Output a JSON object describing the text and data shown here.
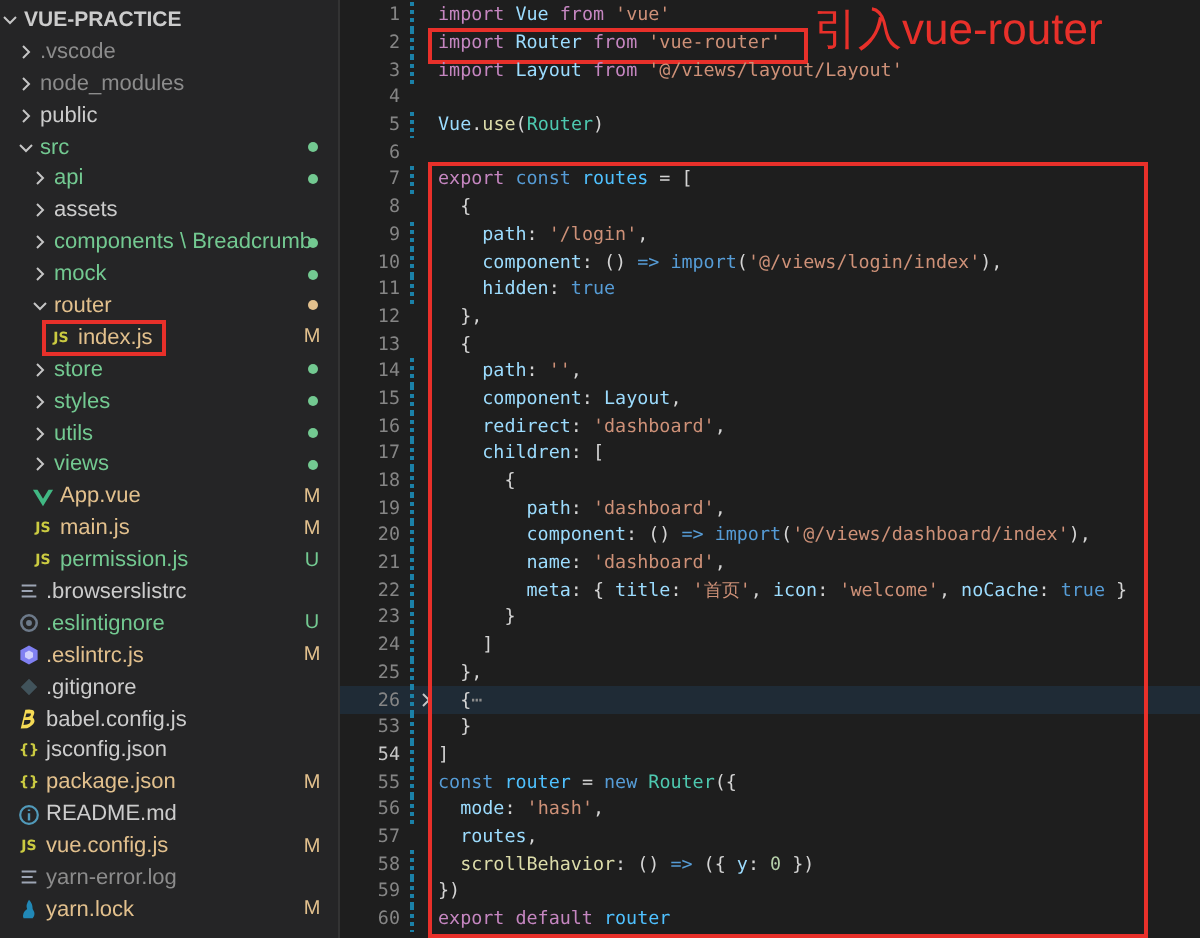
{
  "explorer": {
    "root": {
      "name": "VUE-PRACTICE",
      "kind": "folder",
      "expanded": true,
      "color": "#cccccc",
      "children": [
        {
          "name": ".vscode",
          "kind": "folder",
          "expanded": false,
          "color": "#8c8c8c"
        },
        {
          "name": "node_modules",
          "kind": "folder",
          "expanded": false,
          "color": "#8c8c8c"
        },
        {
          "name": "public",
          "kind": "folder",
          "expanded": false,
          "color": "#cccccc"
        },
        {
          "name": "src",
          "kind": "folder",
          "expanded": true,
          "color": "#73c991",
          "dot": true,
          "children": [
            {
              "name": "api",
              "kind": "folder",
              "expanded": false,
              "color": "#73c991",
              "dot": true
            },
            {
              "name": "assets",
              "kind": "folder",
              "expanded": false,
              "color": "#cccccc"
            },
            {
              "name": "components \\ Breadcrumb",
              "kind": "folder",
              "expanded": false,
              "color": "#73c991",
              "dot": true
            },
            {
              "name": "mock",
              "kind": "folder",
              "expanded": false,
              "color": "#73c991",
              "dot": true
            },
            {
              "name": "router",
              "kind": "folder",
              "expanded": true,
              "color": "#e2c08d",
              "dot": true,
              "children": [
                {
                  "name": "index.js",
                  "kind": "js",
                  "icon_text": "JS",
                  "color": "#e2c08d",
                  "status": "M",
                  "boxed": true
                }
              ]
            },
            {
              "name": "store",
              "kind": "folder",
              "expanded": false,
              "color": "#73c991",
              "dot": true
            },
            {
              "name": "styles",
              "kind": "folder",
              "expanded": false,
              "color": "#73c991",
              "dot": true
            },
            {
              "name": "utils",
              "kind": "folder",
              "expanded": false,
              "color": "#73c991",
              "dot": true
            },
            {
              "name": "views",
              "kind": "folder",
              "expanded": false,
              "color": "#73c991",
              "dot": true
            },
            {
              "name": "App.vue",
              "kind": "vue",
              "color": "#e2c08d",
              "status": "M"
            },
            {
              "name": "main.js",
              "kind": "js",
              "icon_text": "JS",
              "color": "#e2c08d",
              "status": "M"
            },
            {
              "name": "permission.js",
              "kind": "js",
              "icon_text": "JS",
              "color": "#73c991",
              "status": "U"
            }
          ]
        },
        {
          "name": ".browserslistrc",
          "kind": "text",
          "color": "#cccccc"
        },
        {
          "name": ".eslintignore",
          "kind": "ignore",
          "color": "#73c991",
          "status": "U"
        },
        {
          "name": ".eslintrc.js",
          "kind": "eslint",
          "color": "#e2c08d",
          "status": "M"
        },
        {
          "name": ".gitignore",
          "kind": "git",
          "color": "#cccccc"
        },
        {
          "name": "babel.config.js",
          "kind": "babel",
          "color": "#cccccc"
        },
        {
          "name": "jsconfig.json",
          "kind": "json",
          "icon_text": "{}",
          "color": "#cccccc"
        },
        {
          "name": "package.json",
          "kind": "json",
          "icon_text": "{}",
          "color": "#e2c08d",
          "status": "M"
        },
        {
          "name": "README.md",
          "kind": "info",
          "color": "#cccccc"
        },
        {
          "name": "vue.config.js",
          "kind": "js",
          "icon_text": "JS",
          "color": "#e2c08d",
          "status": "M"
        },
        {
          "name": "yarn-error.log",
          "kind": "text",
          "color": "#8c8c8c"
        },
        {
          "name": "yarn.lock",
          "kind": "yarn",
          "color": "#e2c08d",
          "status": "M"
        }
      ]
    }
  },
  "editor": {
    "annotation": "引入vue-router",
    "lines": [
      {
        "number": "1",
        "changed": true,
        "tokens": [
          {
            "kind": "kw",
            "text": "import "
          },
          {
            "kind": "var",
            "text": "Vue "
          },
          {
            "kind": "kw",
            "text": "from "
          },
          {
            "kind": "str",
            "text": "'vue'"
          }
        ]
      },
      {
        "number": "2",
        "changed": true,
        "boxed": true,
        "annotated": true,
        "tokens": [
          {
            "kind": "kw",
            "text": "import "
          },
          {
            "kind": "var",
            "text": "Router "
          },
          {
            "kind": "kw",
            "text": "from "
          },
          {
            "kind": "str",
            "text": "'vue-router'"
          }
        ]
      },
      {
        "number": "3",
        "changed": true,
        "tokens": [
          {
            "kind": "kw",
            "text": "import "
          },
          {
            "kind": "var",
            "text": "Layout "
          },
          {
            "kind": "kw",
            "text": "from "
          },
          {
            "kind": "str",
            "text": "'@/views/layout/Layout'"
          }
        ]
      },
      {
        "number": "4",
        "changed": false
      },
      {
        "number": "5",
        "changed": true,
        "tokens": [
          {
            "kind": "var",
            "text": "Vue"
          },
          {
            "kind": "p",
            "text": "."
          },
          {
            "kind": "fn",
            "text": "use"
          },
          {
            "kind": "p",
            "text": "("
          },
          {
            "kind": "cls",
            "text": "Router"
          },
          {
            "kind": "p",
            "text": ")"
          }
        ]
      },
      {
        "number": "6",
        "changed": false
      },
      {
        "number": "7",
        "changed": true,
        "in_region": true,
        "tokens": [
          {
            "kind": "kw",
            "text": "export "
          },
          {
            "kind": "st",
            "text": "const "
          },
          {
            "kind": "cn",
            "text": "routes "
          },
          {
            "kind": "p",
            "text": "= ["
          }
        ]
      },
      {
        "number": "8",
        "changed": false,
        "in_region": true,
        "tokens": [
          {
            "kind": "p",
            "text": "  {"
          }
        ]
      },
      {
        "number": "9",
        "changed": true,
        "in_region": true,
        "tokens": [
          {
            "kind": "var",
            "text": "    path"
          },
          {
            "kind": "p",
            "text": ": "
          },
          {
            "kind": "str",
            "text": "'/login'"
          },
          {
            "kind": "p",
            "text": ","
          }
        ]
      },
      {
        "number": "10",
        "changed": true,
        "in_region": true,
        "tokens": [
          {
            "kind": "var",
            "text": "    component"
          },
          {
            "kind": "p",
            "text": ": () "
          },
          {
            "kind": "st",
            "text": "=> import"
          },
          {
            "kind": "p",
            "text": "("
          },
          {
            "kind": "str",
            "text": "'@/views/login/index'"
          },
          {
            "kind": "p",
            "text": "),"
          }
        ]
      },
      {
        "number": "11",
        "changed": true,
        "in_region": true,
        "tokens": [
          {
            "kind": "var",
            "text": "    hidden"
          },
          {
            "kind": "p",
            "text": ": "
          },
          {
            "kind": "st",
            "text": "true"
          }
        ]
      },
      {
        "number": "12",
        "changed": false,
        "in_region": true,
        "tokens": [
          {
            "kind": "p",
            "text": "  },"
          }
        ]
      },
      {
        "number": "13",
        "changed": false,
        "in_region": true,
        "tokens": [
          {
            "kind": "p",
            "text": "  {"
          }
        ]
      },
      {
        "number": "14",
        "changed": true,
        "in_region": true,
        "tokens": [
          {
            "kind": "var",
            "text": "    path"
          },
          {
            "kind": "p",
            "text": ": "
          },
          {
            "kind": "str",
            "text": "''"
          },
          {
            "kind": "p",
            "text": ","
          }
        ]
      },
      {
        "number": "15",
        "changed": true,
        "in_region": true,
        "tokens": [
          {
            "kind": "var",
            "text": "    component"
          },
          {
            "kind": "p",
            "text": ": "
          },
          {
            "kind": "var",
            "text": "Layout"
          },
          {
            "kind": "p",
            "text": ","
          }
        ]
      },
      {
        "number": "16",
        "changed": true,
        "in_region": true,
        "tokens": [
          {
            "kind": "var",
            "text": "    redirect"
          },
          {
            "kind": "p",
            "text": ": "
          },
          {
            "kind": "str",
            "text": "'dashboard'"
          },
          {
            "kind": "p",
            "text": ","
          }
        ]
      },
      {
        "number": "17",
        "changed": true,
        "in_region": true,
        "tokens": [
          {
            "kind": "var",
            "text": "    children"
          },
          {
            "kind": "p",
            "text": ": ["
          }
        ]
      },
      {
        "number": "18",
        "changed": true,
        "in_region": true,
        "tokens": [
          {
            "kind": "p",
            "text": "      {"
          }
        ]
      },
      {
        "number": "19",
        "changed": true,
        "in_region": true,
        "tokens": [
          {
            "kind": "var",
            "text": "        path"
          },
          {
            "kind": "p",
            "text": ": "
          },
          {
            "kind": "str",
            "text": "'dashboard'"
          },
          {
            "kind": "p",
            "text": ","
          }
        ]
      },
      {
        "number": "20",
        "changed": true,
        "in_region": true,
        "tokens": [
          {
            "kind": "var",
            "text": "        component"
          },
          {
            "kind": "p",
            "text": ": () "
          },
          {
            "kind": "st",
            "text": "=> import"
          },
          {
            "kind": "p",
            "text": "("
          },
          {
            "kind": "str",
            "text": "'@/views/dashboard/index'"
          },
          {
            "kind": "p",
            "text": "),"
          }
        ]
      },
      {
        "number": "21",
        "changed": true,
        "in_region": true,
        "tokens": [
          {
            "kind": "var",
            "text": "        name"
          },
          {
            "kind": "p",
            "text": ": "
          },
          {
            "kind": "str",
            "text": "'dashboard'"
          },
          {
            "kind": "p",
            "text": ","
          }
        ]
      },
      {
        "number": "22",
        "changed": true,
        "in_region": true,
        "tokens": [
          {
            "kind": "var",
            "text": "        meta"
          },
          {
            "kind": "p",
            "text": ": { "
          },
          {
            "kind": "var",
            "text": "title"
          },
          {
            "kind": "p",
            "text": ": "
          },
          {
            "kind": "str",
            "text": "'首页'"
          },
          {
            "kind": "p",
            "text": ", "
          },
          {
            "kind": "var",
            "text": "icon"
          },
          {
            "kind": "p",
            "text": ": "
          },
          {
            "kind": "str",
            "text": "'welcome'"
          },
          {
            "kind": "p",
            "text": ", "
          },
          {
            "kind": "var",
            "text": "noCache"
          },
          {
            "kind": "p",
            "text": ": "
          },
          {
            "kind": "st",
            "text": "true"
          },
          {
            "kind": "p",
            "text": " }"
          }
        ]
      },
      {
        "number": "23",
        "changed": true,
        "in_region": true,
        "tokens": [
          {
            "kind": "p",
            "text": "      }"
          }
        ]
      },
      {
        "number": "24",
        "changed": true,
        "in_region": true,
        "tokens": [
          {
            "kind": "p",
            "text": "    ]"
          }
        ]
      },
      {
        "number": "25",
        "changed": true,
        "in_region": true,
        "tokens": [
          {
            "kind": "p",
            "text": "  },"
          }
        ]
      },
      {
        "number": "26",
        "changed": true,
        "in_region": true,
        "folded": true,
        "tokens": [
          {
            "kind": "p",
            "text": "  {"
          },
          {
            "kind": "fold",
            "text": "⋯"
          }
        ]
      },
      {
        "number": "53",
        "changed": true,
        "in_region": true,
        "tokens": [
          {
            "kind": "p",
            "text": "  }"
          }
        ]
      },
      {
        "number": "54",
        "changed": true,
        "in_region": true,
        "current": true,
        "tokens": [
          {
            "kind": "p",
            "text": "]"
          }
        ]
      },
      {
        "number": "55",
        "changed": true,
        "in_region": true,
        "tokens": [
          {
            "kind": "st",
            "text": "const "
          },
          {
            "kind": "cn",
            "text": "router "
          },
          {
            "kind": "p",
            "text": "= "
          },
          {
            "kind": "st",
            "text": "new "
          },
          {
            "kind": "cls",
            "text": "Router"
          },
          {
            "kind": "p",
            "text": "({"
          }
        ]
      },
      {
        "number": "56",
        "changed": true,
        "in_region": true,
        "tokens": [
          {
            "kind": "var",
            "text": "  mode"
          },
          {
            "kind": "p",
            "text": ": "
          },
          {
            "kind": "str",
            "text": "'hash'"
          },
          {
            "kind": "p",
            "text": ","
          }
        ]
      },
      {
        "number": "57",
        "changed": false,
        "in_region": true,
        "tokens": [
          {
            "kind": "var",
            "text": "  routes"
          },
          {
            "kind": "p",
            "text": ","
          }
        ]
      },
      {
        "number": "58",
        "changed": true,
        "in_region": true,
        "tokens": [
          {
            "kind": "fn",
            "text": "  scrollBehavior"
          },
          {
            "kind": "p",
            "text": ": () "
          },
          {
            "kind": "st",
            "text": "=> "
          },
          {
            "kind": "p",
            "text": "({ "
          },
          {
            "kind": "var",
            "text": "y"
          },
          {
            "kind": "p",
            "text": ": "
          },
          {
            "kind": "num",
            "text": "0"
          },
          {
            "kind": "p",
            "text": " })"
          }
        ]
      },
      {
        "number": "59",
        "changed": true,
        "in_region": true,
        "tokens": [
          {
            "kind": "p",
            "text": "})"
          }
        ]
      },
      {
        "number": "60",
        "changed": true,
        "in_region": true,
        "tokens": [
          {
            "kind": "kw",
            "text": "export default "
          },
          {
            "kind": "cn",
            "text": "router"
          }
        ]
      }
    ]
  }
}
